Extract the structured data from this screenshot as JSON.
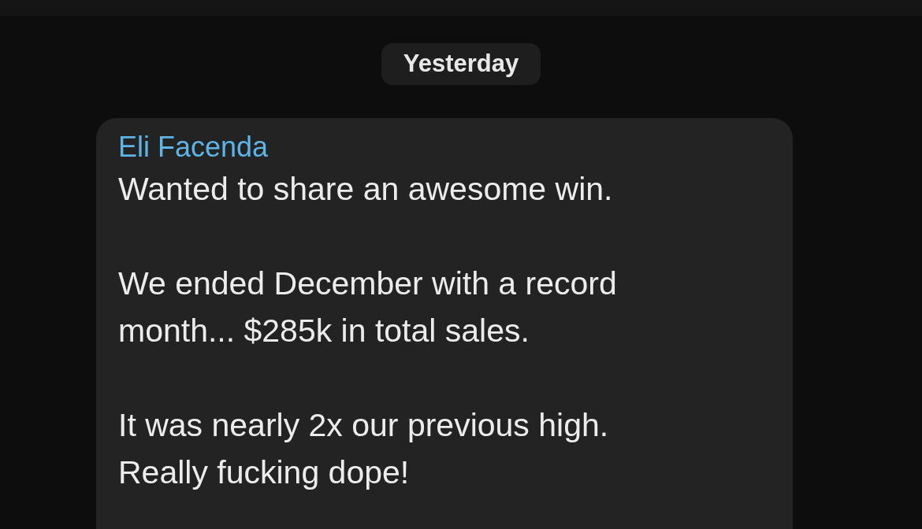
{
  "date_divider": "Yesterday",
  "message": {
    "sender": "Eli Facenda",
    "paragraphs": [
      [
        "Wanted to share an awesome win."
      ],
      [
        "We ended December with a record",
        "month... $285k in total sales."
      ],
      [
        "It was nearly 2x our previous high.",
        "Really fucking dope!"
      ]
    ]
  }
}
